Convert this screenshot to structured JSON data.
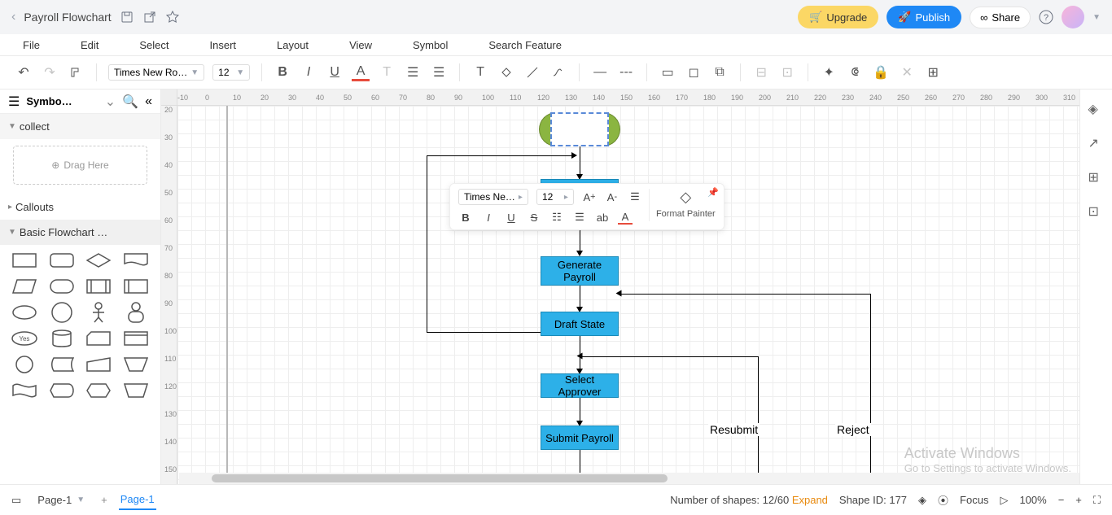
{
  "header": {
    "doc_title": "Payroll Flowchart",
    "upgrade": "Upgrade",
    "publish": "Publish",
    "share": "Share"
  },
  "menu": {
    "file": "File",
    "edit": "Edit",
    "select": "Select",
    "insert": "Insert",
    "layout": "Layout",
    "view": "View",
    "symbol": "Symbol",
    "search_feature": "Search Feature"
  },
  "toolbar": {
    "font": "Times New Ro…",
    "size": "12"
  },
  "sidebar": {
    "title": "Symbo…",
    "collect": "collect",
    "drag_here": "Drag Here",
    "callouts": "Callouts",
    "basic_flowchart": "Basic Flowchart …",
    "yes_shape": "Yes"
  },
  "ruler_h": [
    "-10",
    "0",
    "10",
    "20",
    "30",
    "40",
    "50",
    "60",
    "70",
    "80",
    "90",
    "100",
    "110",
    "120",
    "130",
    "140",
    "150",
    "160",
    "170",
    "180",
    "190",
    "200",
    "210",
    "220",
    "230",
    "240",
    "250",
    "260",
    "270",
    "280",
    "290",
    "300",
    "310"
  ],
  "ruler_v": [
    "20",
    "30",
    "40",
    "50",
    "60",
    "70",
    "80",
    "90",
    "100",
    "110",
    "120",
    "130",
    "140",
    "150"
  ],
  "flowchart": {
    "generate": "Generate Payroll",
    "draft": "Draft State",
    "select_approver": "Select Approver",
    "submit": "Submit Payroll",
    "resubmit": "Resubmit",
    "reject": "Reject"
  },
  "mini_toolbar": {
    "font": "Times Ne…",
    "size": "12",
    "format_painter": "Format Painter",
    "ab": "ab"
  },
  "statusbar": {
    "page1": "Page-1",
    "page1_tab": "Page-1",
    "shapes_count": "Number of shapes: 12/60",
    "expand": "Expand",
    "shape_id": "Shape ID: 177",
    "focus": "Focus",
    "zoom": "100%"
  },
  "watermark": {
    "title": "Activate Windows",
    "sub": "Go to Settings to activate Windows."
  }
}
